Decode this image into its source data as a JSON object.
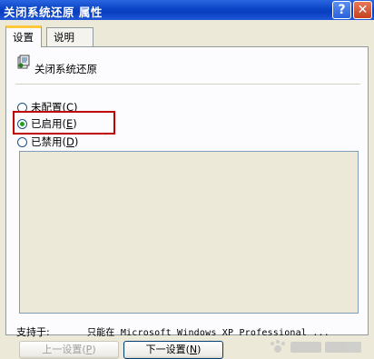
{
  "window": {
    "title": "关闭系统还原 属性",
    "help_glyph": "?",
    "close_glyph": "✕"
  },
  "tabs": [
    {
      "label": "设置",
      "active": true
    },
    {
      "label": "说明",
      "active": false
    }
  ],
  "policy": {
    "name": "关闭系统还原"
  },
  "options": {
    "not_configured": {
      "text": "未配置",
      "key": "C"
    },
    "enabled": {
      "text": "已启用",
      "key": "E"
    },
    "disabled": {
      "text": "已禁用",
      "key": "D"
    },
    "selected": "enabled"
  },
  "supported": {
    "label": "支持于:",
    "value": "只能在 Microsoft Windows XP Professional ..."
  },
  "buttons": {
    "prev": {
      "text": "上一设置",
      "key": "P"
    },
    "next": {
      "text": "下一设置",
      "key": "N"
    }
  },
  "colors": {
    "title_bar": "#0a44c6",
    "highlight": "#c00000",
    "radio_dot": "#21a121"
  }
}
